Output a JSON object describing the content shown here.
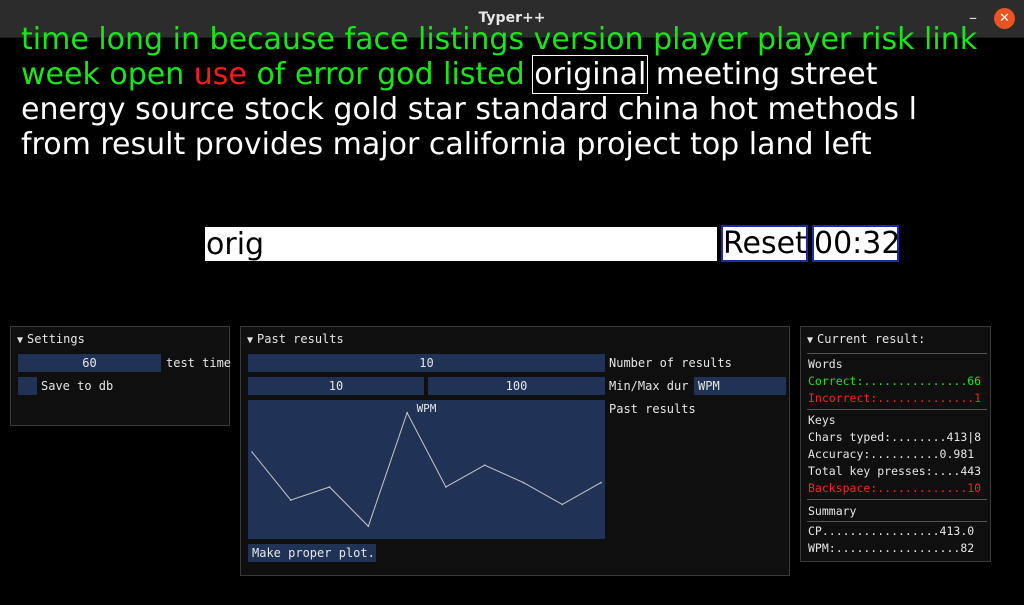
{
  "window": {
    "title": "Typer++"
  },
  "text": {
    "lines": [
      [
        {
          "t": "time",
          "s": "correct"
        },
        {
          "t": "long",
          "s": "correct"
        },
        {
          "t": "in",
          "s": "correct"
        },
        {
          "t": "because",
          "s": "correct"
        },
        {
          "t": "face",
          "s": "correct"
        },
        {
          "t": "listings",
          "s": "correct"
        },
        {
          "t": "version",
          "s": "correct"
        },
        {
          "t": "player",
          "s": "correct"
        },
        {
          "t": "player",
          "s": "correct"
        },
        {
          "t": "risk",
          "s": "correct"
        },
        {
          "t": "link",
          "s": "correct"
        }
      ],
      [
        {
          "t": "week",
          "s": "correct"
        },
        {
          "t": "open",
          "s": "correct"
        },
        {
          "t": "use",
          "s": "wrong"
        },
        {
          "t": "of",
          "s": "correct"
        },
        {
          "t": "error",
          "s": "correct"
        },
        {
          "t": "god",
          "s": "correct"
        },
        {
          "t": "listed",
          "s": "correct"
        },
        {
          "t": "original",
          "s": "current"
        },
        {
          "t": "meeting",
          "s": "pending"
        },
        {
          "t": "street",
          "s": "pending"
        }
      ],
      [
        {
          "t": "energy",
          "s": "pending"
        },
        {
          "t": "source",
          "s": "pending"
        },
        {
          "t": "stock",
          "s": "pending"
        },
        {
          "t": "gold",
          "s": "pending"
        },
        {
          "t": "star",
          "s": "pending"
        },
        {
          "t": "standard",
          "s": "pending"
        },
        {
          "t": "china",
          "s": "pending"
        },
        {
          "t": "hot",
          "s": "pending"
        },
        {
          "t": "methods",
          "s": "pending"
        },
        {
          "t": "l",
          "s": "pending"
        }
      ],
      [
        {
          "t": "from",
          "s": "pending"
        },
        {
          "t": "result",
          "s": "pending"
        },
        {
          "t": "provides",
          "s": "pending"
        },
        {
          "t": "major",
          "s": "pending"
        },
        {
          "t": "california",
          "s": "pending"
        },
        {
          "t": "project",
          "s": "pending"
        },
        {
          "t": "top",
          "s": "pending"
        },
        {
          "t": "land",
          "s": "pending"
        },
        {
          "t": "left",
          "s": "pending"
        }
      ]
    ]
  },
  "typing": {
    "input_value": "orig",
    "reset_label": "Reset",
    "timer": "00:32"
  },
  "settings": {
    "title": "Settings",
    "test_time_value": "60",
    "test_time_label": "test time",
    "save_label": "Save to db"
  },
  "past": {
    "title": "Past results",
    "num_results_value": "10",
    "num_results_label": "Number of results",
    "min_dur": "10",
    "max_dur": "100",
    "minmax_label": "Min/Max dur",
    "metric_value": "WPM",
    "past_results_label": "Past results",
    "plot_title": "WPM",
    "make_plot_label": "Make proper plot."
  },
  "current": {
    "title": "Current result:",
    "words_header": "Words",
    "correct": "Correct:...............66",
    "incorrect": "Incorrect:..............1",
    "keys_header": "Keys",
    "chars_typed": "Chars typed:........413|8",
    "accuracy": "Accuracy:..........0.981",
    "total_keys": "Total key presses:....443",
    "backspace": "Backspace:.............10",
    "summary_header": "Summary",
    "cp": "CP.................413.0",
    "wpm": "WPM:..................82"
  },
  "chart_data": {
    "type": "line",
    "title": "WPM",
    "x": [
      1,
      2,
      3,
      4,
      5,
      6,
      7,
      8,
      9,
      10
    ],
    "series": [
      {
        "values": [
          71,
          60,
          63,
          54,
          80,
          63,
          68,
          64,
          59,
          64
        ]
      }
    ],
    "ylim": [
      52,
      82
    ]
  }
}
